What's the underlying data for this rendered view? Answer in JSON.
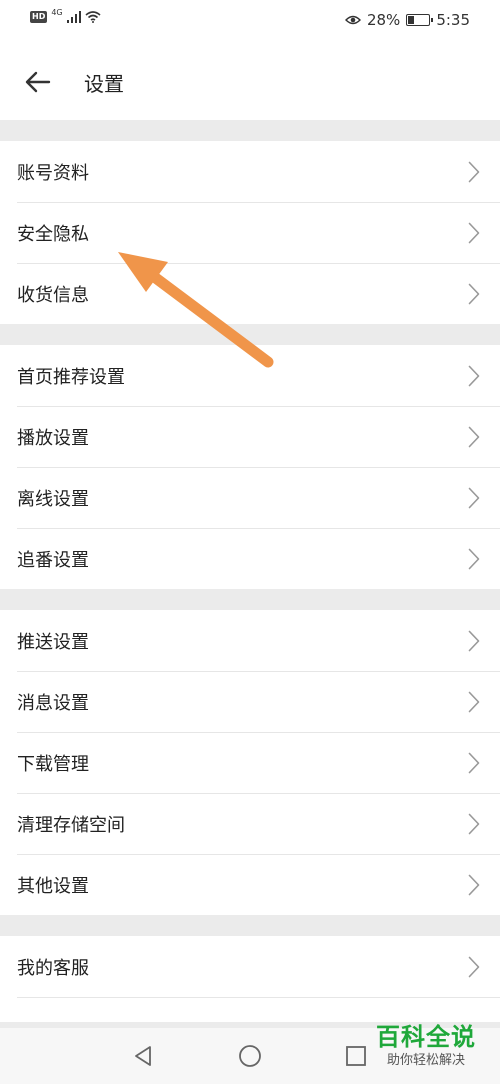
{
  "status": {
    "hd": "HD",
    "network": "4G",
    "battery": "28%",
    "battery_level": 0.28,
    "time": "5:35"
  },
  "header": {
    "title": "设置",
    "back_icon": "arrow-left-icon"
  },
  "groups": [
    {
      "items": [
        "账号资料",
        "安全隐私",
        "收货信息"
      ]
    },
    {
      "items": [
        "首页推荐设置",
        "播放设置",
        "离线设置",
        "追番设置"
      ]
    },
    {
      "items": [
        "推送设置",
        "消息设置",
        "下载管理",
        "清理存储空间",
        "其他设置"
      ]
    },
    {
      "items": [
        "我的客服"
      ]
    }
  ],
  "nav": {
    "back_icon": "triangle-back-icon",
    "home_icon": "circle-home-icon",
    "recents_icon": "square-recents-icon"
  },
  "watermark": {
    "main": "百科全说",
    "sub": "助你轻松解决"
  },
  "colors": {
    "annotation_arrow": "#f0954a",
    "watermark_green": "#1fa83a",
    "background": "#ebebeb"
  }
}
